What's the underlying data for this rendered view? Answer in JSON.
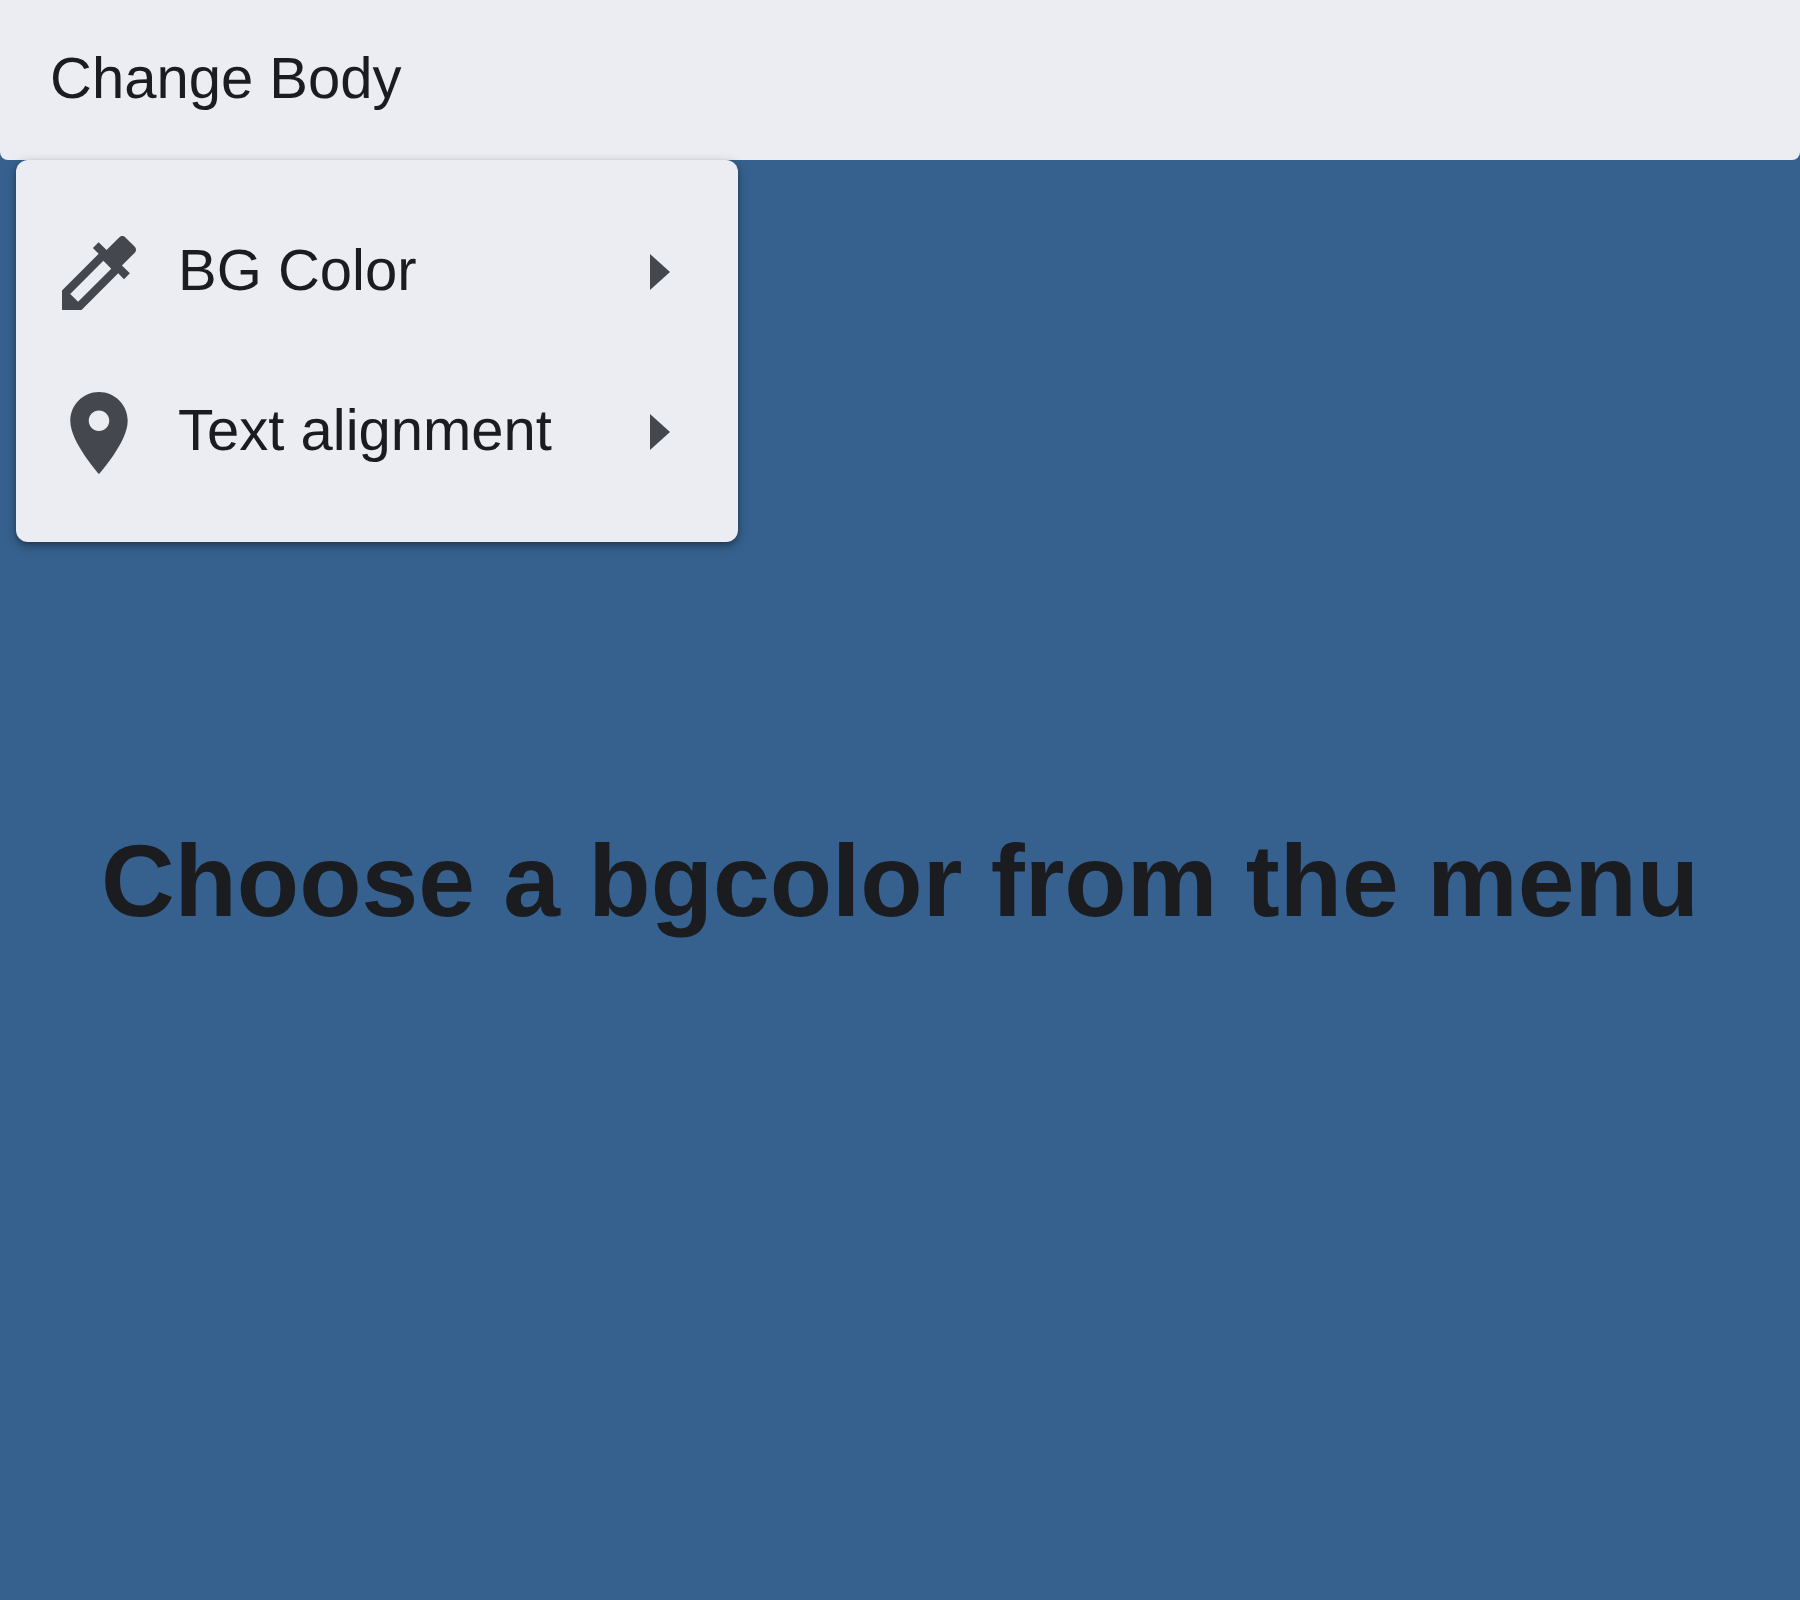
{
  "menubar": {
    "label": "Change Body"
  },
  "menu": {
    "items": [
      {
        "label": "BG Color",
        "submenu": true
      },
      {
        "label": "Text alignment",
        "submenu": true
      }
    ]
  },
  "heading": "Choose a bgcolor from the menu"
}
